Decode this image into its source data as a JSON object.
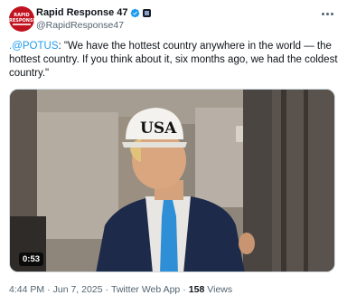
{
  "account": {
    "display_name": "Rapid Response 47",
    "handle": "@RapidResponse47",
    "avatar_text": "RAPID RESPONSE"
  },
  "tweet": {
    "mention": ".@POTUS",
    "text": ": \"We have the hottest country anywhere in the world — the hottest country. If you think about it, six months ago, we had the coldest country.\""
  },
  "media": {
    "duration": "0:53",
    "hat_text": "USA"
  },
  "meta": {
    "time": "4:44 PM",
    "date": "Jun 7, 2025",
    "source": "Twitter Web App",
    "views_count": "158",
    "views_label": "Views",
    "separator": "·"
  },
  "colors": {
    "link": "#1d9bf0",
    "verified": "#1d9bf0",
    "text": "#0f1419",
    "secondary": "#536471",
    "avatar": "#c1121f"
  },
  "icons": {
    "verified": "verified-badge-icon",
    "affiliation": "affiliation-badge-icon",
    "more": "more-options-icon"
  }
}
